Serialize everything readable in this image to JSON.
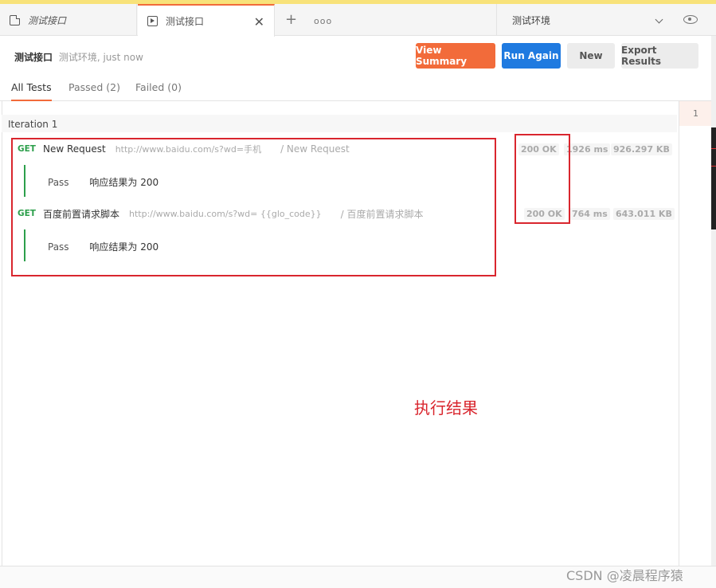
{
  "tabs": [
    {
      "label": "测试接口",
      "icon": "request-icon",
      "style": "italic"
    },
    {
      "label": "测试接口",
      "icon": "runner-icon",
      "active": true
    }
  ],
  "tabbar": {
    "new_tab": "+",
    "more": "ooo"
  },
  "environment": {
    "selected": "测试环境"
  },
  "header": {
    "collection_name": "测试接口",
    "env_time": "测试环境, just now"
  },
  "buttons": {
    "view_summary": "View Summary",
    "run_again": "Run Again",
    "new": "New",
    "export": "Export Results"
  },
  "test_tabs": {
    "all": "All Tests",
    "passed": "Passed (2)",
    "failed": "Failed (0)"
  },
  "iteration": {
    "label": "Iteration 1",
    "number": "1"
  },
  "requests": [
    {
      "method": "GET",
      "name": "New Request",
      "url": "http://www.baidu.com/s?wd=手机",
      "path": "/ New Request",
      "status": "200 OK",
      "time": "1926 ms",
      "size": "926.297 KB",
      "tests": [
        {
          "result": "Pass",
          "text": "响应结果为 200"
        }
      ]
    },
    {
      "method": "GET",
      "name": "百度前置请求脚本",
      "url": "http://www.baidu.com/s?wd= {{glo_code}}",
      "path": "/ 百度前置请求脚本",
      "status": "200 OK",
      "time": "764 ms",
      "size": "643.011 KB",
      "tests": [
        {
          "result": "Pass",
          "text": "响应结果为 200"
        }
      ]
    }
  ],
  "annotation": "执行结果",
  "watermark": "CSDN @凌晨程序猿",
  "colors": {
    "accent": "#f26b3a",
    "primary": "#1f7ae0",
    "pass": "#2c9f4b",
    "annotation": "#d9262e"
  }
}
